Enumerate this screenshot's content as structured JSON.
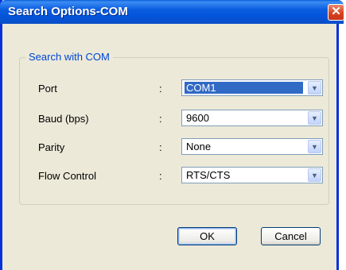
{
  "window": {
    "title": "Search Options-COM",
    "close_glyph": "✕"
  },
  "group": {
    "legend": "Search with COM"
  },
  "fields": [
    {
      "label": "Port",
      "colon": ":",
      "value": "COM1"
    },
    {
      "label": "Baud (bps)",
      "colon": ":",
      "value": "9600"
    },
    {
      "label": "Parity",
      "colon": ":",
      "value": "None"
    },
    {
      "label": "Flow Control",
      "colon": ":",
      "value": "RTS/CTS"
    }
  ],
  "buttons": {
    "ok": "OK",
    "cancel": "Cancel"
  },
  "icons": {
    "dropdown": "chevron-down-icon",
    "close": "close-icon"
  },
  "colors": {
    "titlebar": "#0a5fd8",
    "selection": "#316ac5",
    "legend": "#0046d5",
    "dialog_bg": "#ece9d8"
  }
}
